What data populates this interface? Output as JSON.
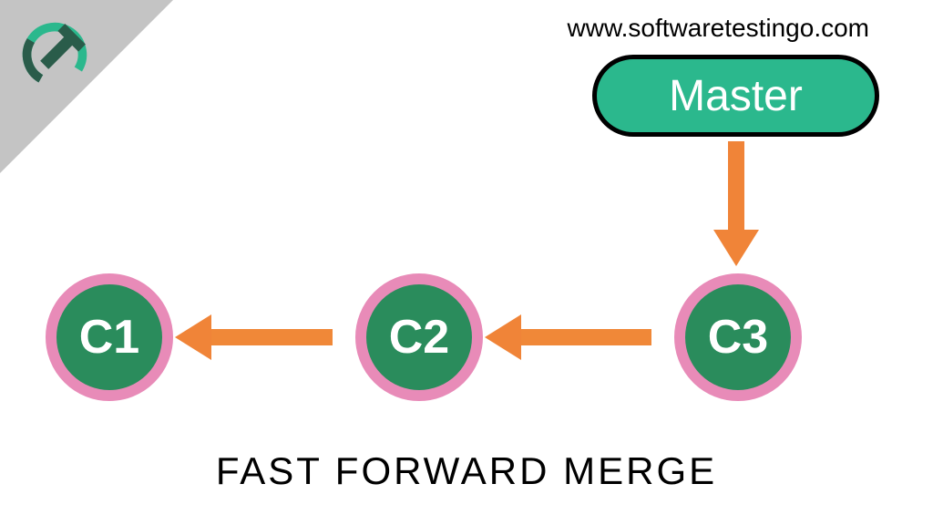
{
  "website_url": "www.softwaretestingo.com",
  "branch_label": "Master",
  "commits": {
    "c1": "C1",
    "c2": "C2",
    "c3": "C3"
  },
  "title": "FAST FORWARD MERGE",
  "colors": {
    "badge_bg": "#2bb88d",
    "commit_bg": "#2a8c5c",
    "commit_border": "#e88bb8",
    "arrow": "#f08438",
    "corner": "#c4c4c4"
  }
}
